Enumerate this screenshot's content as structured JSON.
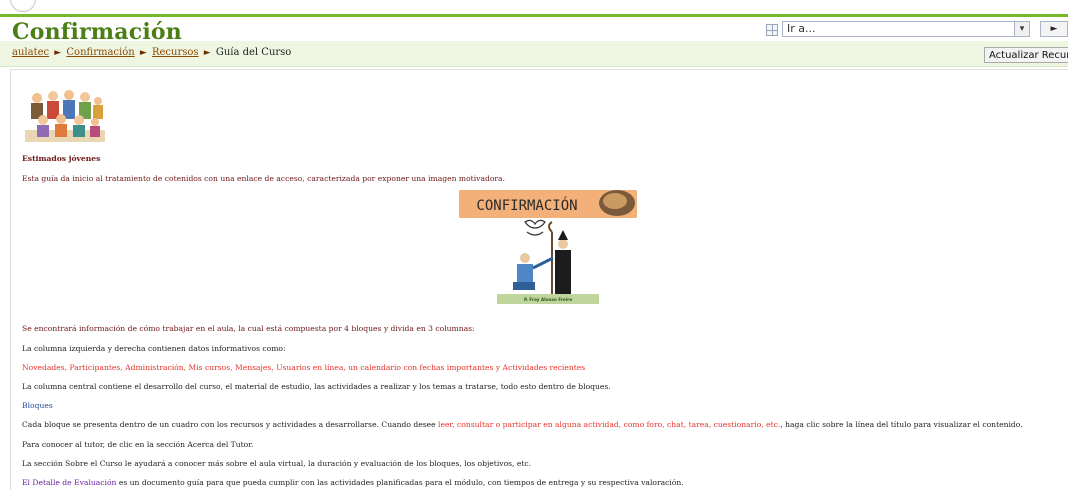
{
  "page": {
    "title": "Confirmación",
    "jump_placeholder": "Ir a...",
    "go_label": "►",
    "update_button": "Actualizar Recurso"
  },
  "breadcrumb": {
    "items": [
      "aulatec",
      "Confirmación",
      "Recursos"
    ],
    "current": "Guía del Curso",
    "separator": "►"
  },
  "content": {
    "greeting": "Estimados jóvenes",
    "intro": "Esta guía da inicio al tratamiento de cotenidos con una enlace de acceso, caracterizada por exponer una imagen motivadora.",
    "poster": {
      "title": "CONFIRMACIÓN",
      "caption": "P. Fray Alonso Freire"
    },
    "p1": "Se encontrará información de cómo trabajar en el aula, la cual está compuesta por 4 bloques y divida en 3 columnas:",
    "p2": "La columna izquierda y derecha contienen datos informativos como:",
    "p3": "Novedades, Participantes, Administración, Mis cursos, Mensajes, Usuarios en línea, un calendario con fechas importantes y Actividades recientes",
    "p4": "La columna central contiene el desarrollo del curso, el material de estudio, las actividades a realizar y los temas a tratarse, todo esto dentro de bloques.",
    "bloques_title": "Bloques",
    "p5a": "Cada bloque se presenta dentro de un cuadro con los recursos y actividades a desarrollarse. Cuando desee ",
    "p5b": "leer, consultar o participar en alguna actividad, como foro, chat, tarea, cuestionario, etc.",
    "p5c": ", haga clic sobre la línea del título para visualizar el contenido.",
    "p6": "Para conocer al tutor, de clic en la sección Acerca del Tutor.",
    "p7": "La sección Sobre el Curso le ayudará a conocer más sobre el aula virtual, la duración y evaluación de los bloques, los objetivos, etc.",
    "p8a": "El Detalle de Evaluación",
    "p8b": " es un documento guía para que pueda cumplir con las actividades planificadas para el módulo, con tiempos de entrega y su respectiva valoración."
  },
  "colors": {
    "title_green": "#4a7f14",
    "accent_line": "#76b82a",
    "breadcrumb_bg": "#eef6e2",
    "text_maroon": "#6e1717",
    "text_red": "#e8332a",
    "link_blue": "#2b4a9b",
    "link_purple": "#6a1ea0",
    "poster_banner": "#f3b078",
    "poster_caption_bg": "#bfd59b"
  }
}
